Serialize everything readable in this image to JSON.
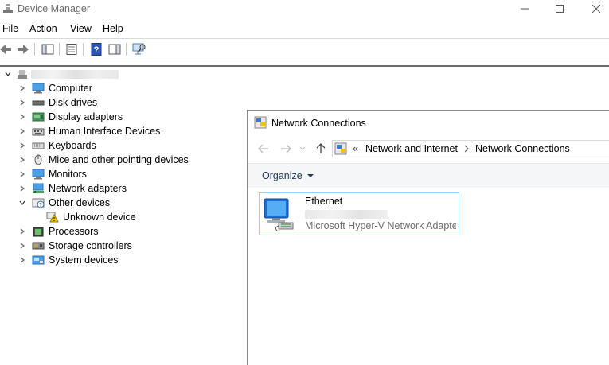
{
  "window": {
    "title": "Device Manager"
  },
  "menu": {
    "items": [
      "File",
      "Action",
      "View",
      "Help"
    ]
  },
  "tree": {
    "host_label": "",
    "categories": [
      {
        "label": "Computer",
        "icon": "computer-icon"
      },
      {
        "label": "Disk drives",
        "icon": "disk-drive-icon"
      },
      {
        "label": "Display adapters",
        "icon": "display-adapter-icon"
      },
      {
        "label": "Human Interface Devices",
        "icon": "hid-icon"
      },
      {
        "label": "Keyboards",
        "icon": "keyboard-icon"
      },
      {
        "label": "Mice and other pointing devices",
        "icon": "mouse-icon"
      },
      {
        "label": "Monitors",
        "icon": "monitor-icon"
      },
      {
        "label": "Network adapters",
        "icon": "network-adapter-icon"
      },
      {
        "label": "Other devices",
        "icon": "other-devices-icon",
        "expanded": true
      },
      {
        "label": "Processors",
        "icon": "processor-icon"
      },
      {
        "label": "Storage controllers",
        "icon": "storage-controller-icon"
      },
      {
        "label": "System devices",
        "icon": "system-devices-icon"
      }
    ],
    "unknown_device": "Unknown device"
  },
  "network_window": {
    "title": "Network Connections",
    "breadcrumb": {
      "prefix": "«",
      "items": [
        "Network and Internet",
        "Network Connections"
      ]
    },
    "organize_label": "Organize",
    "adapter": {
      "name": "Ethernet",
      "description": "Microsoft Hyper-V Network Adapter"
    }
  },
  "colors": {
    "selection_border": "#99d1ff",
    "command_text": "#1e395b",
    "warning": "#f2c100"
  }
}
